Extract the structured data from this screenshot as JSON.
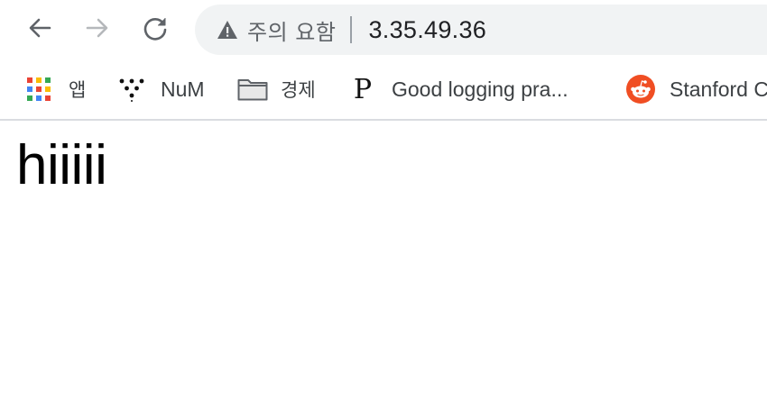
{
  "browser": {
    "security_label": "주의 요함",
    "url": "3.35.49.36"
  },
  "nav": {
    "back_icon": "back-arrow-icon",
    "forward_icon": "forward-arrow-icon",
    "reload_icon": "reload-icon"
  },
  "bookmarks": [
    {
      "label": "앱",
      "icon": "apps-grid-icon"
    },
    {
      "label": "NuM",
      "icon": "dots-logo-icon"
    },
    {
      "label": "경제",
      "icon": "folder-icon"
    },
    {
      "label": "Good logging pra...",
      "icon": "p-logo-icon"
    },
    {
      "label": "Stanford C",
      "icon": "reddit-icon"
    }
  ],
  "page": {
    "heading": "hiiiii"
  },
  "colors": {
    "omnibox_bg": "#f1f3f4",
    "reddit": "#f04e23",
    "apps": [
      "#ea4335",
      "#fbbc05",
      "#34a853",
      "#4285f4"
    ]
  }
}
